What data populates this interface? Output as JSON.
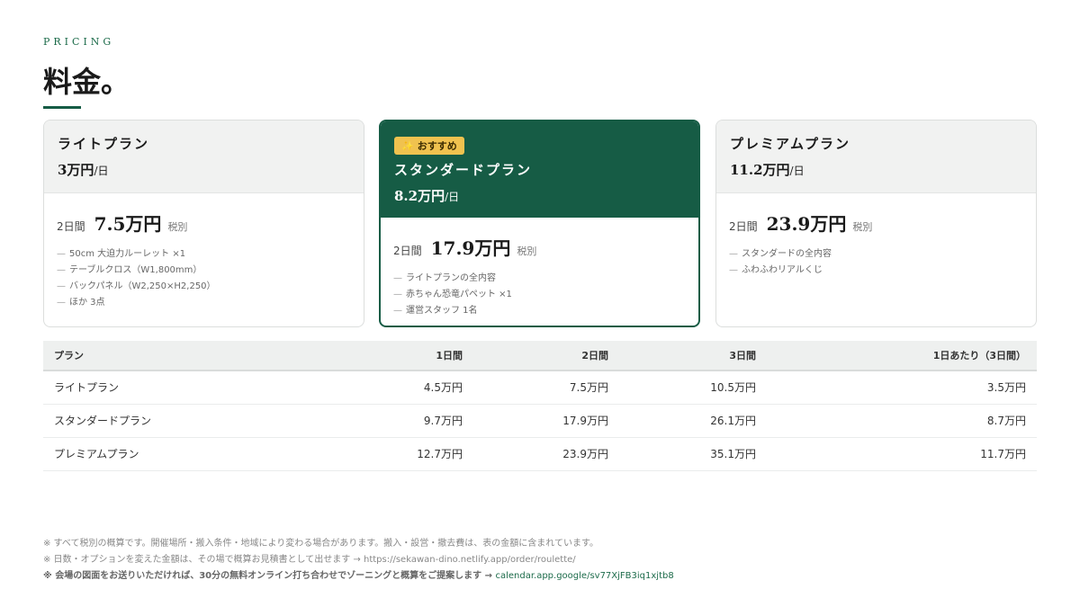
{
  "header": {
    "eyebrow": "PRICING",
    "title": "料金。"
  },
  "cards": [
    {
      "name": "ライトプラン",
      "day_price": "3万円",
      "day_unit": "/日",
      "price_label": "2日間",
      "price": "7.5万円",
      "tax": "税別",
      "features": [
        "50cm 大迫力ルーレット ×1",
        "テーブルクロス（W1,800mm）",
        "バックパネル（W2,250×H2,250）",
        "ほか 3点"
      ]
    },
    {
      "badge_icon": "✨",
      "badge": "おすすめ",
      "name": "スタンダードプラン",
      "day_price": "8.2万円",
      "day_unit": "/日",
      "price_label": "2日間",
      "price": "17.9万円",
      "tax": "税別",
      "features": [
        "ライトプランの全内容",
        "赤ちゃん恐竜パペット ×1",
        "運営スタッフ 1名"
      ]
    },
    {
      "name": "プレミアムプラン",
      "day_price": "11.2万円",
      "day_unit": "/日",
      "price_label": "2日間",
      "price": "23.9万円",
      "tax": "税別",
      "features": [
        "スタンダードの全内容",
        "ふわふわリアルくじ"
      ]
    }
  ],
  "dash": "—",
  "table": {
    "headers": [
      "プラン",
      "1日間",
      "2日間",
      "3日間",
      "1日あたり（3日間）"
    ],
    "rows": [
      [
        "ライトプラン",
        "4.5万円",
        "7.5万円",
        "10.5万円",
        "3.5万円"
      ],
      [
        "スタンダードプラン",
        "9.7万円",
        "17.9万円",
        "26.1万円",
        "8.7万円"
      ],
      [
        "プレミアムプラン",
        "12.7万円",
        "23.9万円",
        "35.1万円",
        "11.7万円"
      ]
    ]
  },
  "notes": {
    "line1": "※ すべて税別の概算です。開催場所・搬入条件・地域により変わる場合があります。搬入・設営・撤去費は、表の金額に含まれています。",
    "line2_text": "※ 日数・オプションを変えた金額は、その場で概算お見積書として出せます → ",
    "line2_link": "https://sekawan-dino.netlify.app/order/roulette/",
    "line3_text": "※ 会場の図面をお送りいただければ、30分の無料オンライン打ち合わせでゾーニングと概算をご提案します → ",
    "line3_link": "calendar.app.google/sv77XjFB3iq1xjtb8"
  },
  "colors": {
    "accent": "#165c45",
    "badge": "#f0c24f"
  }
}
